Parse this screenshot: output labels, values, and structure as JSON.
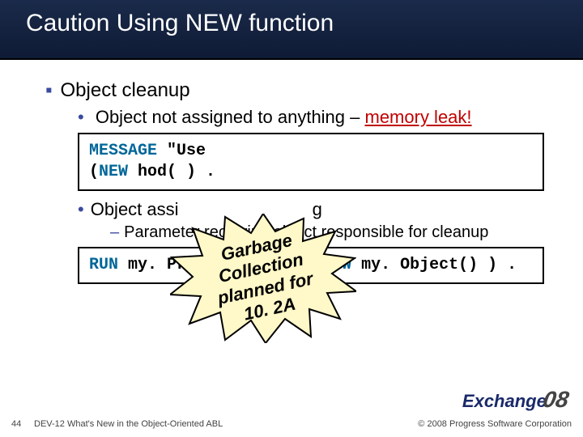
{
  "header": {
    "title": "Caution Using NEW function"
  },
  "bullets": {
    "l1": "Object cleanup",
    "l2_a_pre": "Object not assigned to anything – ",
    "l2_a_leak": "memory leak!",
    "l2_b": "Object assi",
    "l2_b_tail": "g",
    "l3": "Parameter receiving object responsible for cleanup"
  },
  "code1": {
    "line1_a": "MESSAGE",
    "line1_b": " \"Use",
    "line2_a": "        (",
    "line2_b": "NEW",
    "line2_c": "                       hod( ) ."
  },
  "code2": {
    "a": "RUN",
    "b": " my. Proc. p ( ",
    "c": "INPUT NEW",
    "d": " my. Object() ) ."
  },
  "burst": {
    "l1": "Garbage",
    "l2": "Collection",
    "l3": "planned for",
    "l4": "10. 2A"
  },
  "footer": {
    "page": "44",
    "title": "DEV-12 What's New in the Object-Oriented ABL",
    "copyright": "© 2008 Progress Software Corporation"
  },
  "logo": {
    "brand": "Exchange",
    "year": "08"
  }
}
